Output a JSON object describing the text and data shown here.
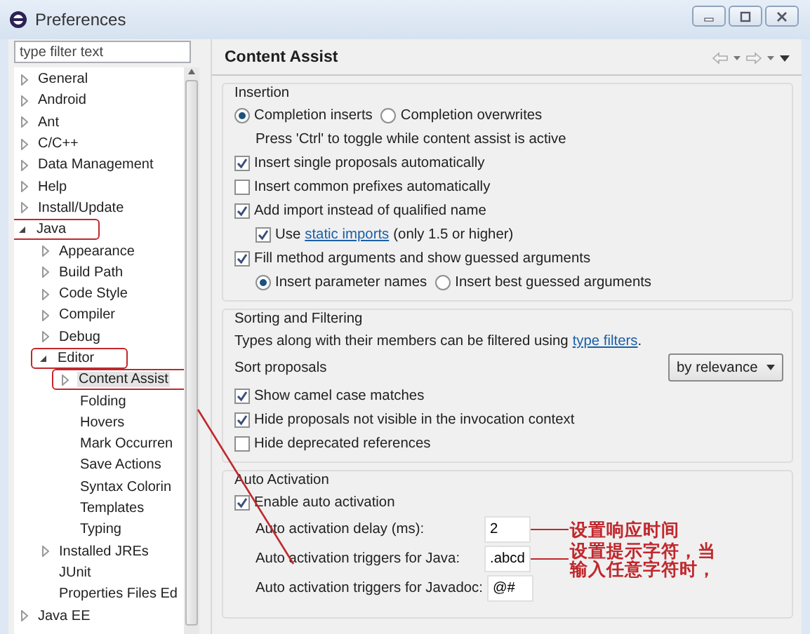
{
  "window": {
    "title": "Preferences"
  },
  "filter": {
    "placeholder": "type filter text"
  },
  "tree": [
    {
      "label": "General",
      "expanded": false,
      "selected": false,
      "annotated": false
    },
    {
      "label": "Android",
      "expanded": false,
      "selected": false,
      "annotated": false
    },
    {
      "label": "Ant",
      "expanded": false,
      "selected": false,
      "annotated": false
    },
    {
      "label": "C/C++",
      "expanded": false,
      "selected": false,
      "annotated": false
    },
    {
      "label": "Data Management",
      "expanded": false,
      "selected": false,
      "annotated": false
    },
    {
      "label": "Help",
      "expanded": false,
      "selected": false,
      "annotated": false
    },
    {
      "label": "Install/Update",
      "expanded": false,
      "selected": false,
      "annotated": false
    },
    {
      "label": "Java",
      "expanded": true,
      "selected": false,
      "annotated": true,
      "children": [
        {
          "label": "Appearance",
          "expanded": false,
          "selected": false,
          "annotated": false
        },
        {
          "label": "Build Path",
          "expanded": false,
          "selected": false,
          "annotated": false
        },
        {
          "label": "Code Style",
          "expanded": false,
          "selected": false,
          "annotated": false
        },
        {
          "label": "Compiler",
          "expanded": false,
          "selected": false,
          "annotated": false
        },
        {
          "label": "Debug",
          "expanded": false,
          "selected": false,
          "annotated": false
        },
        {
          "label": "Editor",
          "expanded": true,
          "selected": false,
          "annotated": true,
          "children": [
            {
              "label": "Content Assist",
              "expanded": false,
              "selected": true,
              "annotated": true
            },
            {
              "label": "Folding",
              "selected": false,
              "annotated": false
            },
            {
              "label": "Hovers",
              "selected": false,
              "annotated": false
            },
            {
              "label": "Mark Occurren",
              "selected": false,
              "annotated": false
            },
            {
              "label": "Save Actions",
              "selected": false,
              "annotated": false
            },
            {
              "label": "Syntax Colorin",
              "selected": false,
              "annotated": false
            },
            {
              "label": "Templates",
              "selected": false,
              "annotated": false
            },
            {
              "label": "Typing",
              "selected": false,
              "annotated": false
            }
          ]
        },
        {
          "label": "Installed JREs",
          "expanded": false,
          "selected": false,
          "annotated": false
        },
        {
          "label": "JUnit",
          "selected": false,
          "annotated": false
        },
        {
          "label": "Properties Files Ed",
          "selected": false,
          "annotated": false
        }
      ]
    },
    {
      "label": "Java EE",
      "expanded": false,
      "selected": false,
      "annotated": false
    }
  ],
  "page": {
    "title": "Content Assist"
  },
  "groups": [
    {
      "title": "Insertion",
      "rows": [
        {
          "kind": "radios",
          "options": [
            {
              "label": "Completion inserts",
              "selected": true
            },
            {
              "label": "Completion overwrites",
              "selected": false
            }
          ]
        },
        {
          "kind": "note",
          "text": "Press 'Ctrl' to toggle while content assist is active"
        },
        {
          "kind": "checkbox",
          "label": "Insert single proposals automatically",
          "checked": true
        },
        {
          "kind": "checkbox",
          "label": "Insert common prefixes automatically",
          "checked": false
        },
        {
          "kind": "checkbox",
          "label": "Add import instead of qualified name",
          "checked": true,
          "children": [
            {
              "kind": "checkbox",
              "label": "Use",
              "link": "static imports",
              "after": "(only 1.5 or higher)",
              "checked": true
            }
          ]
        },
        {
          "kind": "checkbox",
          "label": "Fill method arguments and show guessed arguments",
          "checked": true,
          "children": [
            {
              "kind": "radios",
              "options": [
                {
                  "label": "Insert parameter names",
                  "selected": true
                },
                {
                  "label": "Insert best guessed arguments",
                  "selected": false
                }
              ]
            }
          ]
        }
      ]
    },
    {
      "title": "Sorting and Filtering",
      "rows": [
        {
          "kind": "text",
          "text": "Types along with their members can be filtered using",
          "link": "type filters",
          "after": "."
        },
        {
          "kind": "select",
          "label": "Sort proposals",
          "value": "by relevance"
        },
        {
          "kind": "checkbox",
          "label": "Show camel case matches",
          "checked": true
        },
        {
          "kind": "checkbox",
          "label": "Hide proposals not visible in the invocation context",
          "checked": true
        },
        {
          "kind": "checkbox",
          "label": "Hide deprecated references",
          "checked": false
        }
      ]
    },
    {
      "title": "Auto Activation",
      "rows": [
        {
          "kind": "checkbox",
          "label": "Enable auto activation",
          "checked": true,
          "children": [
            {
              "kind": "field",
              "label": "Auto activation delay (ms):",
              "value": "2",
              "annotation": [
                "设置响应时间"
              ]
            },
            {
              "kind": "field",
              "label": "Auto activation triggers for Java:",
              "value": ".abcd",
              "annotation": [
                "设置提示字符，当",
                "输入任意字符时，"
              ]
            },
            {
              "kind": "field",
              "label": "Auto activation triggers for Javadoc:",
              "value": "@#"
            }
          ]
        }
      ]
    }
  ]
}
